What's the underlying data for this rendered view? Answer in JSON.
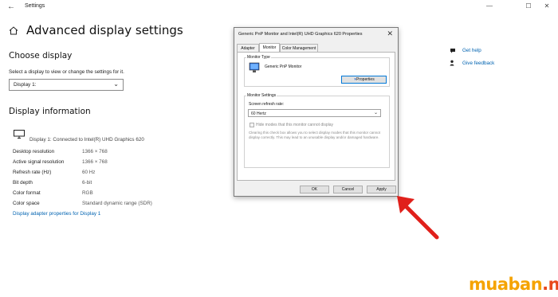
{
  "window": {
    "app_title": "Settings",
    "back_glyph": "←",
    "minimize_glyph": "—",
    "maximize_glyph": "☐",
    "close_glyph": "✕"
  },
  "page": {
    "title": "Advanced display settings"
  },
  "choose_display": {
    "heading": "Choose display",
    "instruction": "Select a display to view or change the settings for it.",
    "selected": "Display 1:"
  },
  "display_info": {
    "heading": "Display information",
    "connection": "Display 1: Connected to Intel(R) UHD Graphics 620",
    "rows": [
      {
        "label": "Desktop resolution",
        "value": "1366 × 768"
      },
      {
        "label": "Active signal resolution",
        "value": "1366 × 768"
      },
      {
        "label": "Refresh rate (Hz)",
        "value": "60 Hz"
      },
      {
        "label": "Bit depth",
        "value": "6-bit"
      },
      {
        "label": "Color format",
        "value": "RGB"
      },
      {
        "label": "Color space",
        "value": "Standard dynamic range (SDR)"
      }
    ],
    "adapter_link": "Display adapter properties for Display 1"
  },
  "help": {
    "get_help": "Get help",
    "give_feedback": "Give feedback"
  },
  "dialog": {
    "title": "Generic PnP Monitor and Intel(R) UHD Graphics 620 Properties",
    "close_glyph": "✕",
    "tabs": [
      "Adapter",
      "Monitor",
      "Color Management"
    ],
    "active_tab": "Monitor",
    "monitor_type": {
      "group_label": "Monitor Type",
      "monitor_name": "Generic PnP Monitor",
      "properties_button": "Properties"
    },
    "monitor_settings": {
      "group_label": "Monitor Settings",
      "refresh_label": "Screen refresh rate:",
      "refresh_value": "60 Hertz",
      "hide_modes_label": "Hide modes that this monitor cannot display",
      "hide_modes_checked": false,
      "warning": "Clearing this check box allows you to select display modes that this monitor cannot display correctly. This may lead to an unusable display and/or damaged hardware."
    },
    "buttons": {
      "ok": "OK",
      "cancel": "Cancel",
      "apply": "Apply"
    }
  },
  "annotation": {
    "arrow_color": "#e0201b"
  },
  "watermark": {
    "part1": "muaban",
    "part2": ".net",
    "color1": "#f5a300",
    "color2": "#e8481c"
  }
}
